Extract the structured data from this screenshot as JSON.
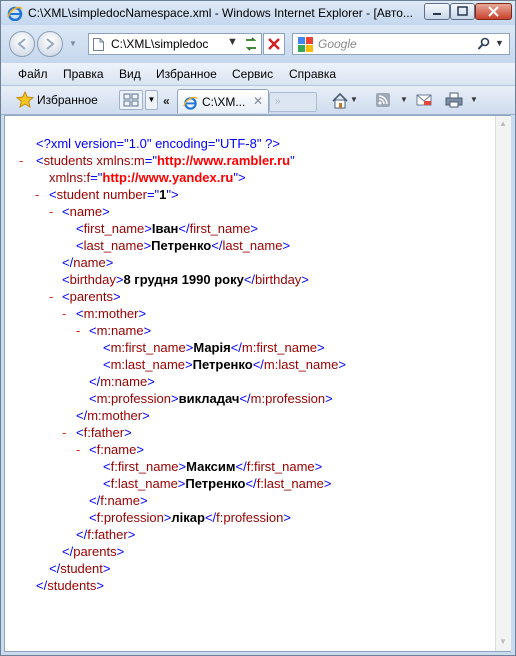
{
  "window": {
    "title": "C:\\XML\\simpledocNamespace.xml - Windows Internet Explorer - [Авто..."
  },
  "address_bar": {
    "url": "C:\\XML\\simpledoc"
  },
  "search": {
    "placeholder": "Google"
  },
  "menu": {
    "items": [
      "Файл",
      "Правка",
      "Вид",
      "Избранное",
      "Сервис",
      "Справка"
    ]
  },
  "favorites_bar": {
    "label": "Избранное",
    "tab_label": "C:\\XM..."
  },
  "colors": {
    "markup_blue": "#0000ff",
    "tag_name": "#990000",
    "collapse_minus": "#e4231a",
    "attr_value": "#ff0000"
  },
  "xml": {
    "declaration": "<?xml version=\"1.0\" encoding=\"UTF-8\" ?>",
    "students_tag": "students",
    "ns_m_name": "xmlns:m",
    "ns_m_value": "http://www.rambler.ru",
    "ns_f_name": "xmlns:f",
    "ns_f_value": "http://www.yandex.ru",
    "student_tag": "student",
    "number_attr": "number",
    "number_value": "1",
    "name_tag": "name",
    "first_name_tag": "first_name",
    "first_name_value": "Іван",
    "last_name_tag": "last_name",
    "last_name_value": "Петренко",
    "birthday_tag": "birthday",
    "birthday_value": "8 грудня 1990 року",
    "parents_tag": "parents",
    "mother_tag": "m:mother",
    "m_name_tag": "m:name",
    "m_first_name_tag": "m:first_name",
    "m_first_name_value": "Марія",
    "m_last_name_tag": "m:last_name",
    "m_last_name_value": "Петренко",
    "m_profession_tag": "m:profession",
    "m_profession_value": "викладач",
    "father_tag": "f:father",
    "f_name_tag": "f:name",
    "f_first_name_tag": "f:first_name",
    "f_first_name_value": "Максим",
    "f_last_name_tag": "f:last_name",
    "f_last_name_value": "Петренко",
    "f_profession_tag": "f:profession",
    "f_profession_value": "лікар",
    "collapse_sign": "-"
  }
}
